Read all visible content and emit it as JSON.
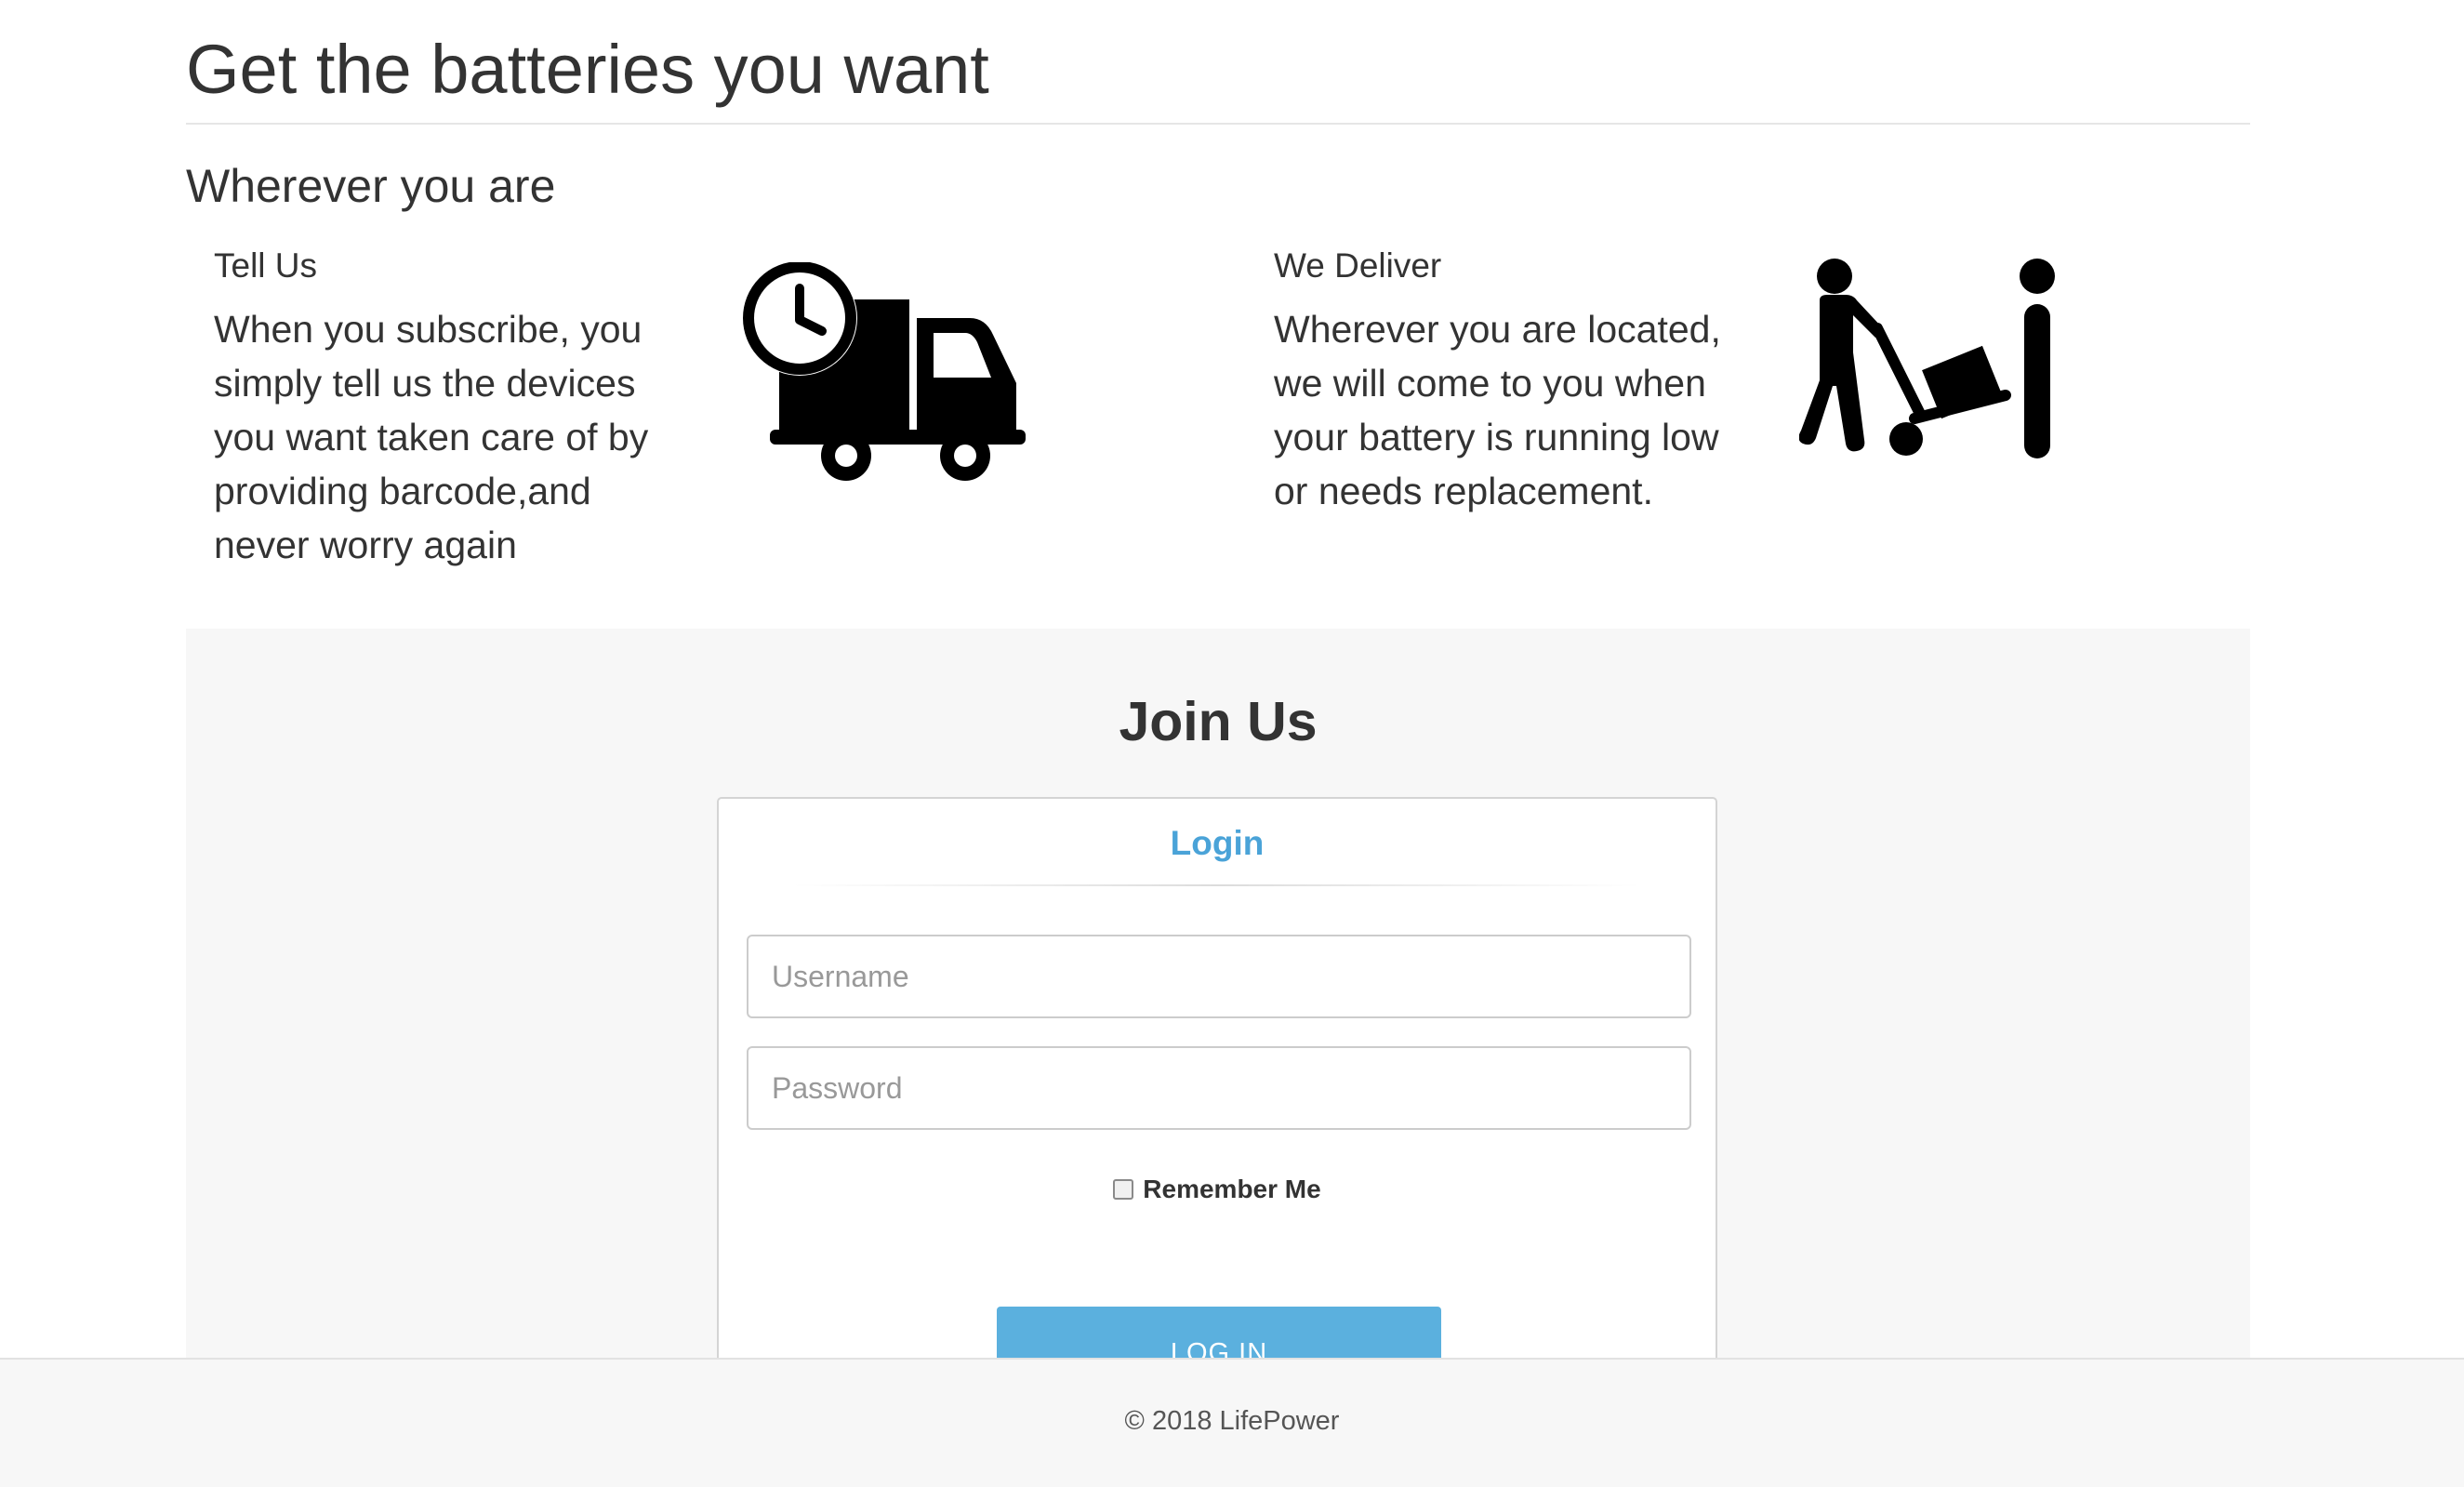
{
  "header": {
    "title": "Get the batteries you want",
    "subtitle": "Wherever you are"
  },
  "features": [
    {
      "heading": "Tell Us",
      "lines": [
        "When you subscribe, you",
        "simply tell us the devices",
        "you want taken care of by",
        "providing barcode,and",
        "never worry again"
      ],
      "icon": "delivery-truck-clock-icon"
    },
    {
      "heading": "We Deliver",
      "lines": [
        "Wherever you are located,",
        "we will come to you when",
        "your battery is running low",
        "or needs replacement."
      ],
      "icon": "person-hand-truck-delivery-icon"
    }
  ],
  "join": {
    "title": "Join Us",
    "login": {
      "title": "Login",
      "username_placeholder": "Username",
      "password_placeholder": "Password",
      "remember_label": "Remember Me",
      "remember_checked": false,
      "button_label": "LOG IN"
    }
  },
  "footer": {
    "text": "© 2018 LifePower"
  },
  "colors": {
    "accent": "#5bb0de",
    "login_title": "#4aa3d8",
    "panel_background": "#f7f7f7",
    "text": "#333333"
  }
}
